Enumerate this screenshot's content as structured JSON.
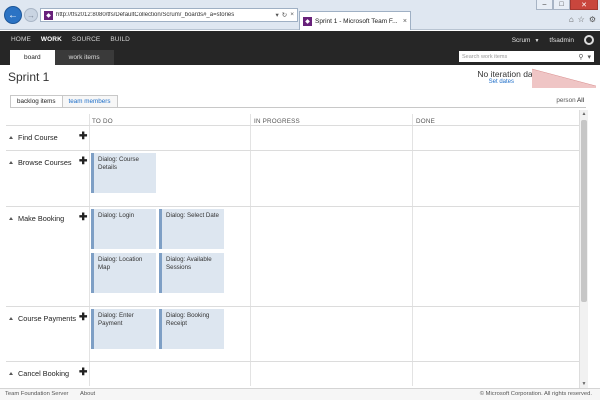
{
  "browser": {
    "url": "http://tfs2012:8080/tfs/DefaultCollection/Scrum/_boards#_a=stories",
    "tab_title": "Sprint 1 - Microsoft Team F...",
    "tab_close": "×",
    "window_controls": [
      "–",
      "□",
      "✕"
    ]
  },
  "header": {
    "nav": [
      "HOME",
      "WORK",
      "SOURCE",
      "BUILD"
    ],
    "active_nav": "WORK",
    "project": "Scrum",
    "user": "tfsadmin",
    "sub_tabs": [
      "board",
      "work items"
    ],
    "search_placeholder": "Search work items"
  },
  "page": {
    "title": "Sprint 1",
    "iteration_status": "No iteration dates",
    "set_dates_link": "Set dates"
  },
  "view_tabs": [
    "backlog items",
    "team members"
  ],
  "filter": {
    "label": "person",
    "value": "All"
  },
  "board": {
    "columns": [
      "TO DO",
      "IN PROGRESS",
      "DONE"
    ],
    "rows": [
      {
        "title": "Find Course",
        "cards": []
      },
      {
        "title": "Browse Courses",
        "cards": [
          [
            "Dialog: Course Details"
          ]
        ]
      },
      {
        "title": "Make Booking",
        "cards": [
          [
            "Dialog: Login",
            "Dialog: Select Date"
          ],
          [
            "Dialog: Location Map",
            "Dialog: Available Sessions"
          ]
        ]
      },
      {
        "title": "Course Payments",
        "cards": [
          [
            "Dialog: Enter Payment",
            "Dialog: Booking Receipt"
          ]
        ]
      },
      {
        "title": "Cancel Booking",
        "cards": []
      }
    ]
  },
  "footer": {
    "brand": "Team Foundation Server",
    "about": "About",
    "copyright": "© Microsoft Corporation. All rights reserved."
  },
  "colors": {
    "header_bg": "#262626",
    "card_bg": "#dde6f0",
    "card_accent": "#7e9fc5",
    "link": "#1e6ec8"
  },
  "icons": [
    "back-arrow-icon",
    "forward-arrow-icon",
    "site-icon",
    "search-icon",
    "refresh-icon",
    "home-icon",
    "star-icon",
    "gear-icon",
    "add-icon",
    "collapse-triangle-icon"
  ]
}
